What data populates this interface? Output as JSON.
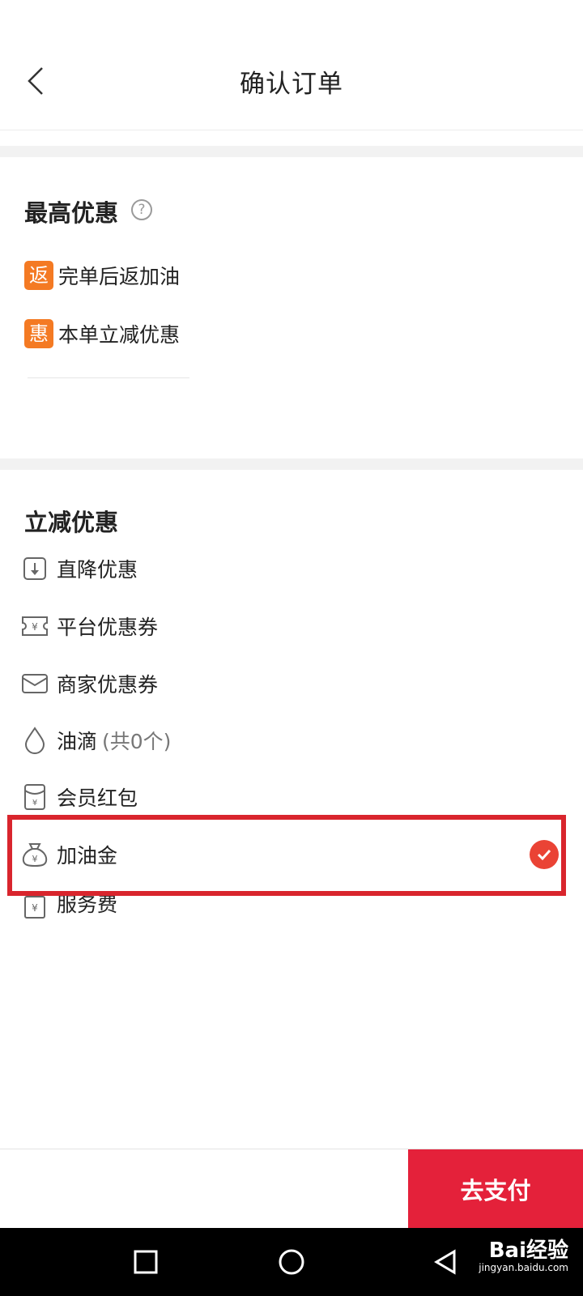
{
  "header": {
    "title": "确认订单"
  },
  "best_offer": {
    "title": "最高优惠",
    "help_icon": "?",
    "badges": [
      {
        "tag": "返",
        "label": "完单后返加油"
      },
      {
        "tag": "惠",
        "label": "本单立减优惠"
      }
    ]
  },
  "discounts": {
    "title": "立减优惠",
    "items": [
      {
        "icon": "arrow-down-box-icon",
        "label": "直降优惠"
      },
      {
        "icon": "platform-coupon-icon",
        "label": "平台优惠券"
      },
      {
        "icon": "merchant-coupon-icon",
        "label": "商家优惠券"
      },
      {
        "icon": "oil-drop-icon",
        "label": "油滴",
        "extra": "(共0个)"
      },
      {
        "icon": "red-envelope-icon",
        "label": "会员红包"
      },
      {
        "icon": "money-bag-icon",
        "label": "加油金",
        "selected": true
      },
      {
        "icon": "service-fee-icon",
        "label": "服务费"
      }
    ]
  },
  "footer": {
    "pay_label": "去支付"
  },
  "watermark": {
    "brand": "Bai经验",
    "url": "jingyan.baidu.com"
  },
  "colors": {
    "accent_red": "#e4213a",
    "badge_orange": "#f47a23",
    "check_red": "#ea4335"
  }
}
